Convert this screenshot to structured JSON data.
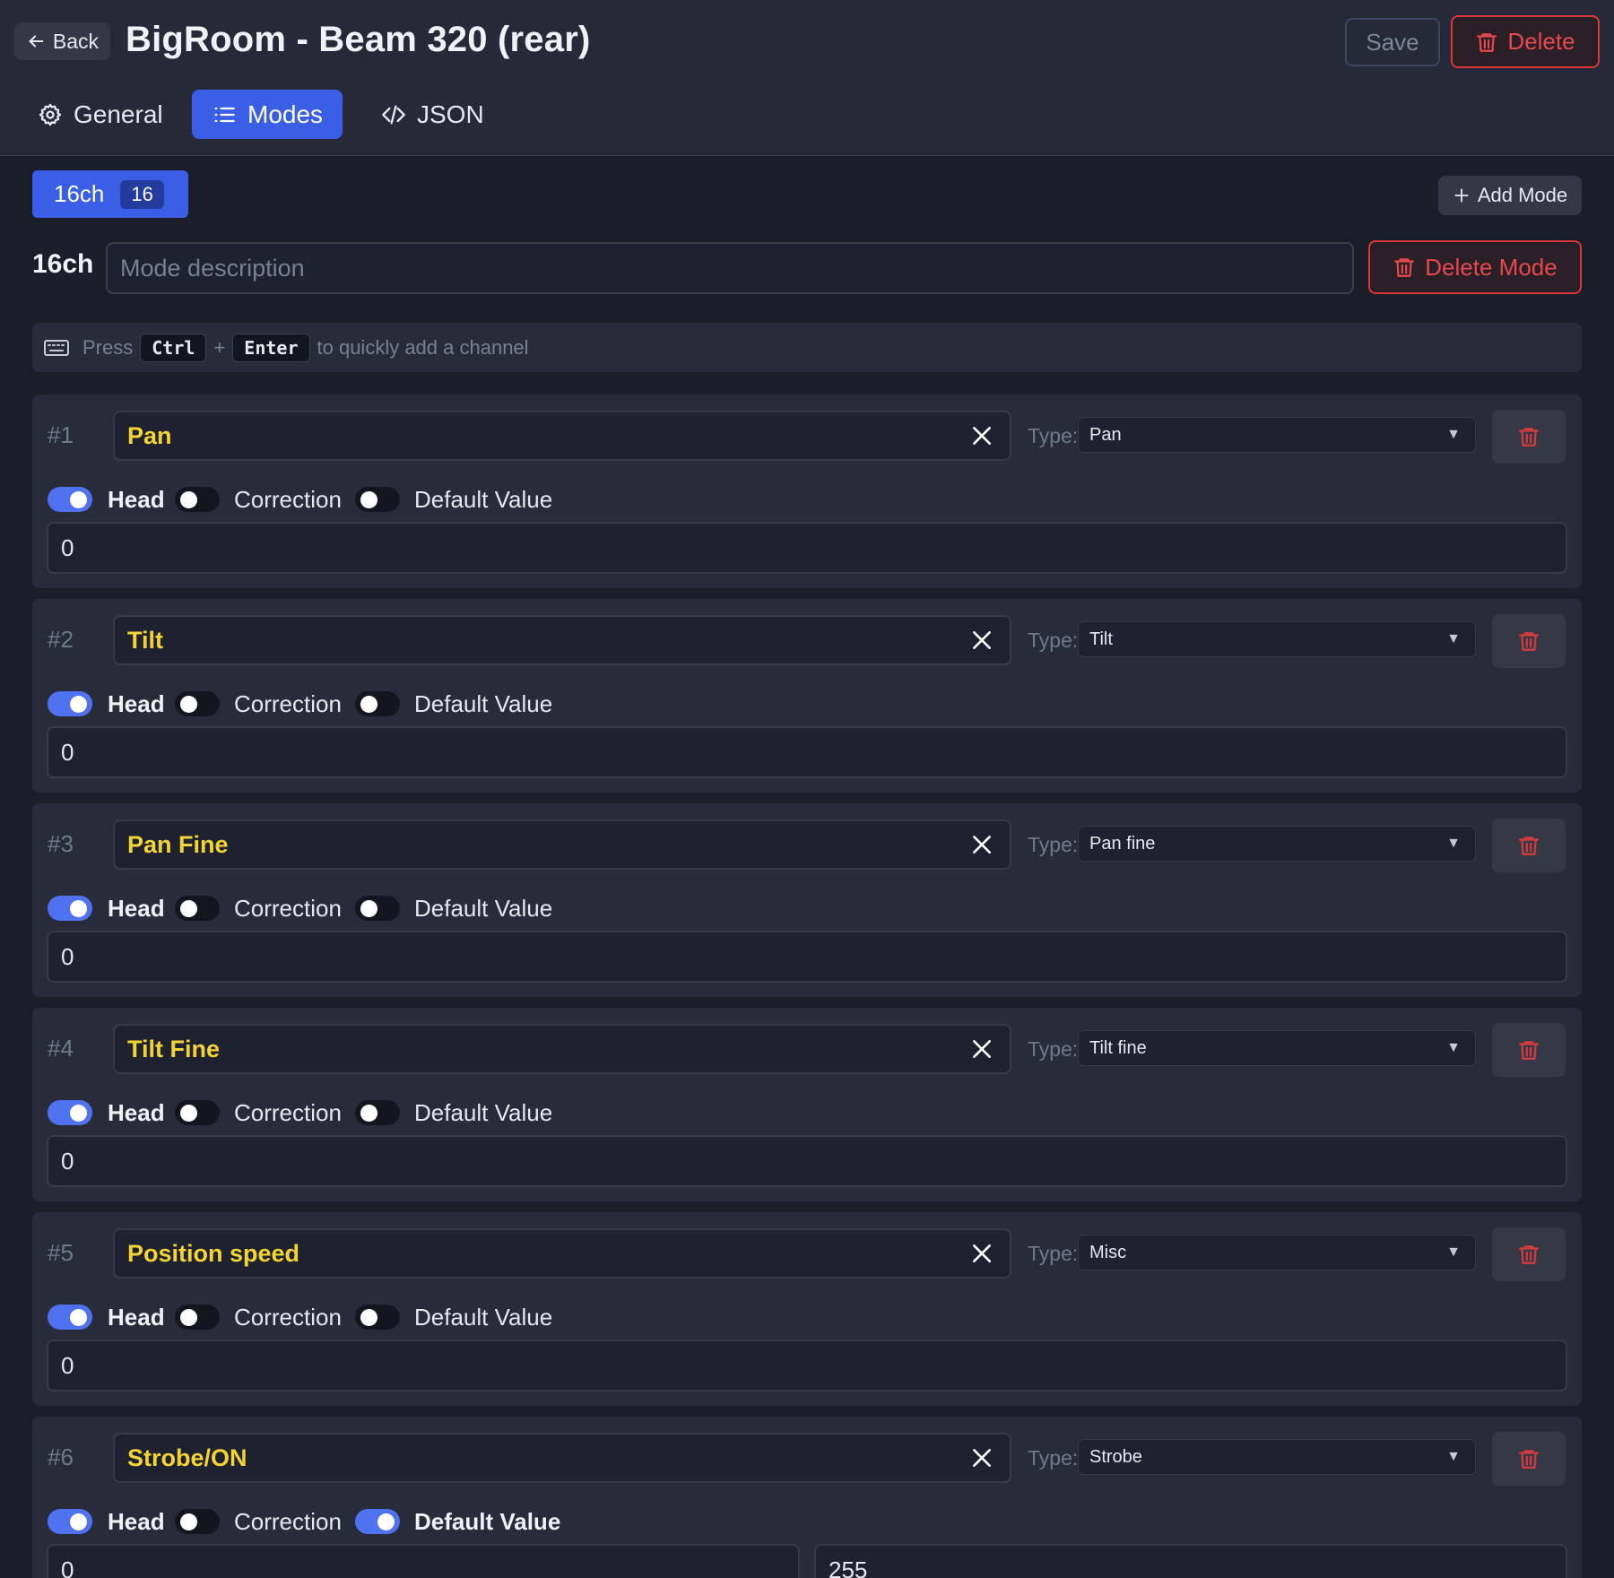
{
  "header": {
    "back_label": "Back",
    "title": "BigRoom - Beam 320 (rear)",
    "save_label": "Save",
    "delete_label": "Delete"
  },
  "tabs": [
    {
      "label": "General",
      "icon": "gear-icon",
      "active": false
    },
    {
      "label": "Modes",
      "icon": "list-icon",
      "active": true
    },
    {
      "label": "JSON",
      "icon": "code-icon",
      "active": false
    }
  ],
  "mode": {
    "chip_label": "16ch",
    "chip_count": "16",
    "add_mode_label": "Add Mode",
    "name": "16ch",
    "description_value": "",
    "description_placeholder": "Mode description",
    "delete_mode_label": "Delete Mode"
  },
  "hint": {
    "prefix": "Press",
    "key1": "Ctrl",
    "plus": "+",
    "key2": "Enter",
    "suffix": "to quickly add a channel"
  },
  "labels": {
    "type": "Type:",
    "head": "Head",
    "correction": "Correction",
    "default_value": "Default Value"
  },
  "channels": [
    {
      "num": "#1",
      "name": "Pan",
      "type": "Pan",
      "head": true,
      "correction": false,
      "default_enabled": false,
      "values": [
        "0"
      ]
    },
    {
      "num": "#2",
      "name": "Tilt",
      "type": "Tilt",
      "head": true,
      "correction": false,
      "default_enabled": false,
      "values": [
        "0"
      ]
    },
    {
      "num": "#3",
      "name": "Pan Fine",
      "type": "Pan fine",
      "head": true,
      "correction": false,
      "default_enabled": false,
      "values": [
        "0"
      ]
    },
    {
      "num": "#4",
      "name": "Tilt Fine",
      "type": "Tilt fine",
      "head": true,
      "correction": false,
      "default_enabled": false,
      "values": [
        "0"
      ]
    },
    {
      "num": "#5",
      "name": "Position speed",
      "type": "Misc",
      "head": true,
      "correction": false,
      "default_enabled": false,
      "values": [
        "0"
      ]
    },
    {
      "num": "#6",
      "name": "Strobe/ON",
      "type": "Strobe",
      "head": true,
      "correction": false,
      "default_enabled": true,
      "values": [
        "0",
        "255"
      ]
    }
  ],
  "colors": {
    "accent": "#3a5ee6",
    "danger": "#e5484d",
    "channel_name": "#f4d433",
    "background": "#1b1e29",
    "header_bg": "#252938",
    "card_bg": "#282c3a"
  }
}
